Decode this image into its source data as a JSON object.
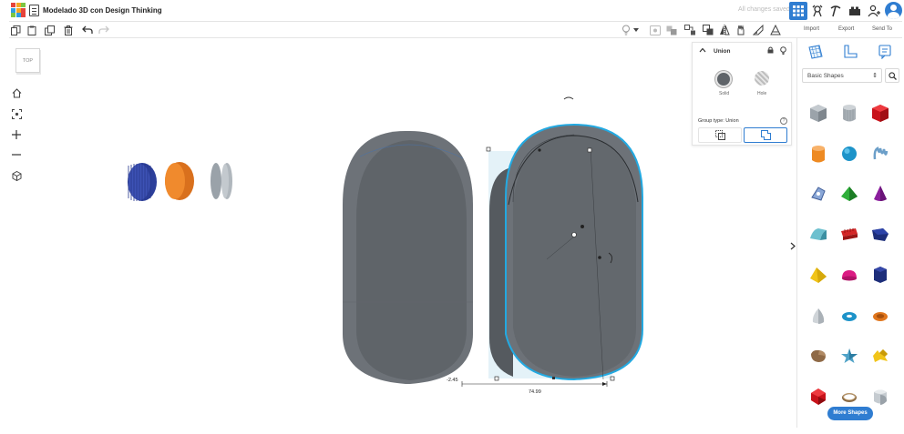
{
  "app": {
    "title": "Modelado 3D con Design Thinking",
    "save_status": "All changes saved",
    "logo_colors": [
      "#e6443b",
      "#f5a623",
      "#7ec542",
      "#2f9de4",
      "#f5a623",
      "#e6443b",
      "#7ec542",
      "#2f9de4",
      "#e6443b"
    ],
    "accent": "#2f7dd1"
  },
  "panel_tabs": {
    "import": "Import",
    "export": "Export",
    "send_to": "Send To"
  },
  "viewcube": {
    "label": "TOP"
  },
  "inspector": {
    "title": "Union",
    "solid_label": "Solid",
    "hole_label": "Hole",
    "group_type_label": "Group type: Union"
  },
  "library": {
    "category": "Basic Shapes",
    "more_label": "More Shapes",
    "shapes": [
      "box-shape",
      "cylinder-shape",
      "red-box-shape",
      "orange-cylinder-shape",
      "sphere-shape",
      "scribble-shape",
      "shape-generator-shape",
      "pyramid-shape",
      "cone-shape",
      "roof-shape",
      "text-shape",
      "polygon-shape",
      "yellow-pyramid-shape",
      "half-sphere-shape",
      "hexagonal-prism-shape",
      "paraboloid-shape",
      "torus-shape",
      "tube-shape",
      "rock-shape",
      "star-shape",
      "blob-shape",
      "icosahedron-shape",
      "ring-shape",
      "round-box-shape"
    ]
  },
  "dimensions": {
    "width": "74.99",
    "offset": "-2.45"
  }
}
